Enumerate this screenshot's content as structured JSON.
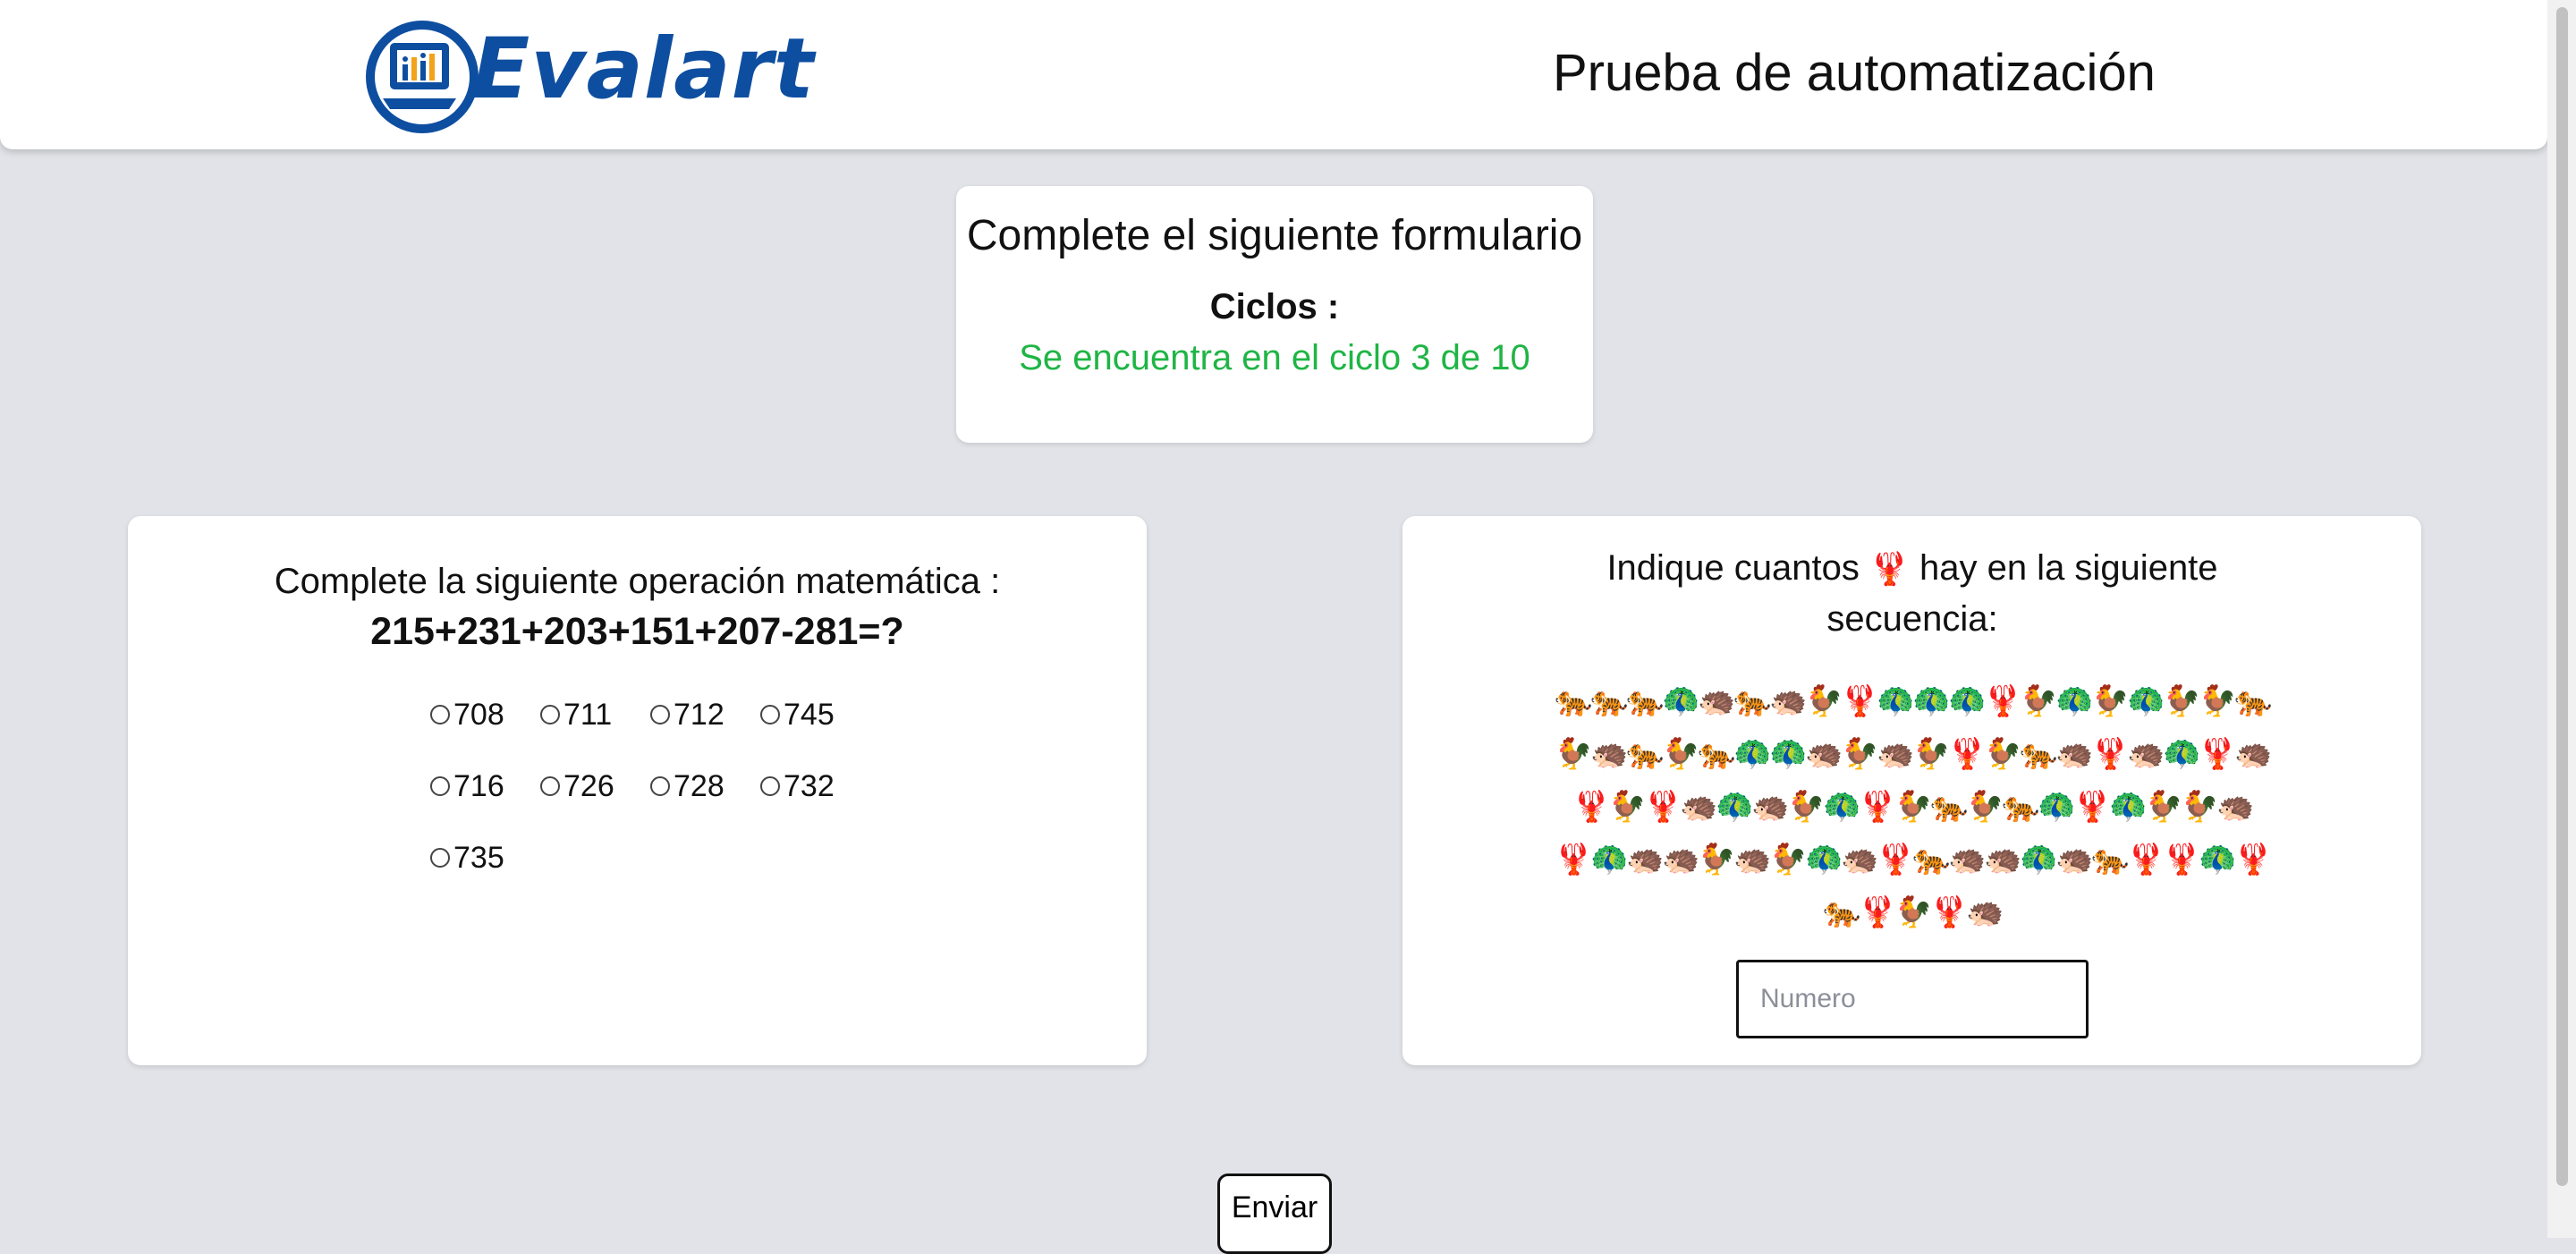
{
  "header": {
    "logo_text": "Evalart",
    "title": "Prueba de automatización"
  },
  "cycles_card": {
    "title": "Complete el siguiente formulario",
    "label": "Ciclos :",
    "status": "Se encuentra en el ciclo 3 de 10",
    "status_color": "#1fb545"
  },
  "math_card": {
    "question": "Complete la siguiente operación matemática :",
    "expression": "215+231+203+151+207-281=?",
    "options": [
      [
        "708",
        "711",
        "712",
        "745"
      ],
      [
        "716",
        "726",
        "728",
        "732"
      ],
      [
        "735"
      ]
    ]
  },
  "count_card": {
    "question_before": "Indique cuantos",
    "target_emoji": "🦞",
    "question_after": "hay en la siguiente secuencia:",
    "sequence": [
      "🐅🐅🐅🦚🦔🐅🦔🐓🦞🦚🦚🦚🦞🐓🦚🐓🦚🐓🐓🐅",
      "🐓🦔🐅🐓🐅🦚🦚🦔🐓🦔🐓🦞🐓🐅🦔🦞🦔🦚🦞🦔",
      "🦞🐓🦞🦔🦚🦔🐓🦚🦞🐓🐅🐓🐅🦚🦞🦚🐓🐓🦔",
      "🦞🦚🦔🦔🐓🦔🐓🦚🦔🦞🐅🦔🦔🦚🦔🐅🦞🦞🦚🦞",
      "🐅🦞🐓🦞🦔"
    ],
    "input_placeholder": "Numero"
  },
  "submit_label": "Enviar",
  "colors": {
    "background": "#e1e3e8",
    "brand_blue": "#0e4ea0",
    "logo_accent": "#f2a21b"
  }
}
